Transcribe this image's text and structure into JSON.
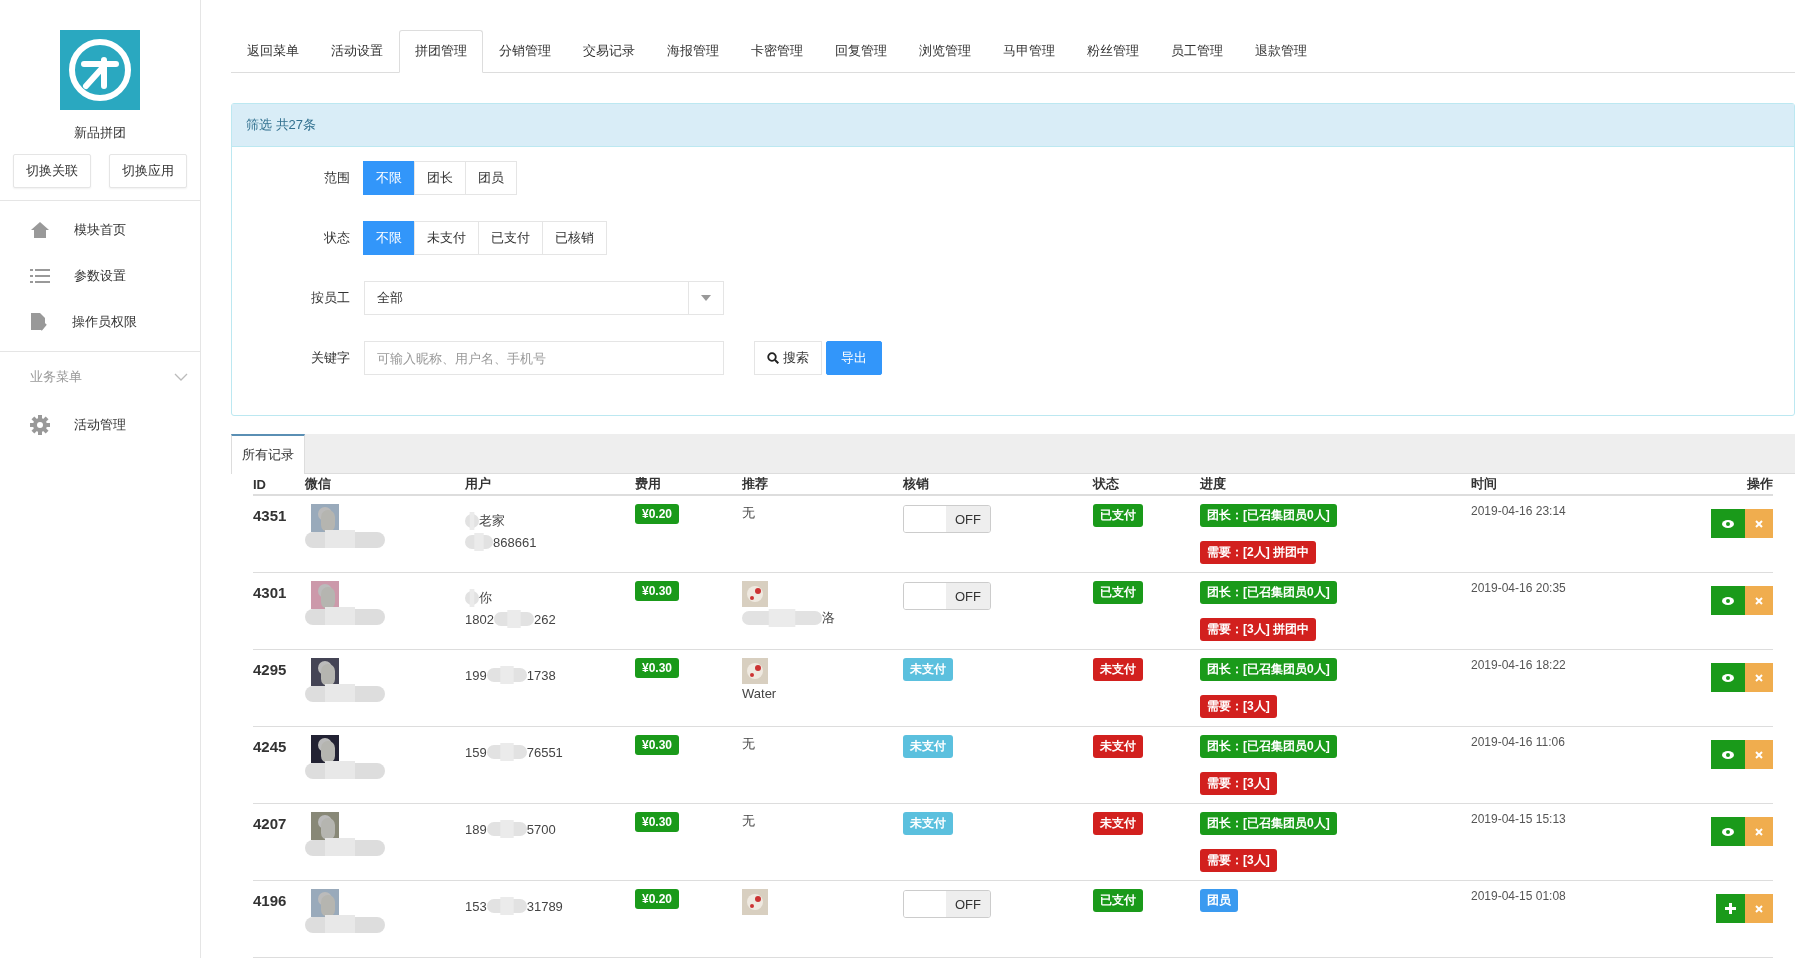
{
  "sidebar": {
    "app_name": "新品拼团",
    "buttons": [
      "切换关联",
      "切换应用"
    ],
    "items": [
      {
        "label": "模块首页"
      },
      {
        "label": "参数设置"
      },
      {
        "label": "操作员权限"
      }
    ],
    "section": {
      "title": "业务菜单",
      "expanded": true,
      "items": [
        {
          "label": "活动管理"
        }
      ]
    }
  },
  "tabs": [
    {
      "label": "返回菜单",
      "selected": false
    },
    {
      "label": "活动设置",
      "selected": false
    },
    {
      "label": "拼团管理",
      "selected": true
    },
    {
      "label": "分销管理",
      "selected": false
    },
    {
      "label": "交易记录",
      "selected": false
    },
    {
      "label": "海报管理",
      "selected": false
    },
    {
      "label": "卡密管理",
      "selected": false
    },
    {
      "label": "回复管理",
      "selected": false
    },
    {
      "label": "浏览管理",
      "selected": false
    },
    {
      "label": "马甲管理",
      "selected": false
    },
    {
      "label": "粉丝管理",
      "selected": false
    },
    {
      "label": "员工管理",
      "selected": false
    },
    {
      "label": "退款管理",
      "selected": false
    }
  ],
  "filter": {
    "title": "筛选 共27条",
    "groups": [
      {
        "label": "范围",
        "options": [
          {
            "label": "不限",
            "selected": true
          },
          {
            "label": "团长",
            "selected": false
          },
          {
            "label": "团员",
            "selected": false
          }
        ]
      },
      {
        "label": "状态",
        "options": [
          {
            "label": "不限",
            "selected": true
          },
          {
            "label": "未支付",
            "selected": false
          },
          {
            "label": "已支付",
            "selected": false
          },
          {
            "label": "已核销",
            "selected": false
          }
        ]
      }
    ],
    "staff": {
      "label": "按员工",
      "value": "全部"
    },
    "keyword": {
      "label": "关键字",
      "placeholder": "可输入昵称、用户名、手机号"
    },
    "search_button": "搜索",
    "export_button": "导出"
  },
  "records": {
    "tab": "所有记录",
    "columns": [
      "ID",
      "微信",
      "用户",
      "费用",
      "推荐",
      "核销",
      "状态",
      "进度",
      "时间",
      "操作"
    ],
    "rows": [
      {
        "id": "4351",
        "user": {
          "name": "老家",
          "phone_end": "868661"
        },
        "fee": "¥0.20",
        "recommend": {
          "kind": "none",
          "text": "无"
        },
        "verify": {
          "kind": "toggle",
          "on": false,
          "text": "OFF"
        },
        "status": {
          "text": "已支付",
          "color": "#1a9a1a"
        },
        "progress": [
          {
            "text": "团长：[已召集团员0人]",
            "color": "#1a9a1a"
          },
          {
            "text": "需要：[2人] 拼团中",
            "color": "#d2201e"
          }
        ],
        "time": "2019-04-16 23:14",
        "kind": "leader"
      },
      {
        "id": "4301",
        "user": {
          "name": "你",
          "phone_start": "1802",
          "phone_end": "262"
        },
        "fee": "¥0.30",
        "recommend": {
          "kind": "blurred",
          "text": "洛"
        },
        "verify": {
          "kind": "toggle",
          "on": false,
          "text": "OFF"
        },
        "status": {
          "text": "已支付",
          "color": "#1a9a1a"
        },
        "progress": [
          {
            "text": "团长：[已召集团员0人]",
            "color": "#1a9a1a"
          },
          {
            "text": "需要：[3人] 拼团中",
            "color": "#d2201e"
          }
        ],
        "time": "2019-04-16 20:35",
        "kind": "leader"
      },
      {
        "id": "4295",
        "user": {
          "phone_start": "199",
          "phone_end": "1738"
        },
        "fee": "¥0.30",
        "recommend": {
          "kind": "avatar",
          "text": "Water"
        },
        "verify": {
          "kind": "badge",
          "text": "未支付"
        },
        "status": {
          "text": "未支付",
          "color": "#d2201e"
        },
        "progress": [
          {
            "text": "团长：[已召集团员0人]",
            "color": "#1a9a1a"
          },
          {
            "text": "需要：[3人]",
            "color": "#d2201e"
          }
        ],
        "time": "2019-04-16 18:22",
        "kind": "leader"
      },
      {
        "id": "4245",
        "user": {
          "phone_start": "159",
          "phone_end": "76551"
        },
        "fee": "¥0.30",
        "recommend": {
          "kind": "none",
          "text": "无"
        },
        "verify": {
          "kind": "badge",
          "text": "未支付"
        },
        "status": {
          "text": "未支付",
          "color": "#d2201e"
        },
        "progress": [
          {
            "text": "团长：[已召集团员0人]",
            "color": "#1a9a1a"
          },
          {
            "text": "需要：[3人]",
            "color": "#d2201e"
          }
        ],
        "time": "2019-04-16 11:06",
        "kind": "leader"
      },
      {
        "id": "4207",
        "user": {
          "phone_start": "189",
          "phone_end": "5700"
        },
        "fee": "¥0.30",
        "recommend": {
          "kind": "none",
          "text": "无"
        },
        "verify": {
          "kind": "badge",
          "text": "未支付"
        },
        "status": {
          "text": "未支付",
          "color": "#d2201e"
        },
        "progress": [
          {
            "text": "团长：[已召集团员0人]",
            "color": "#1a9a1a"
          },
          {
            "text": "需要：[3人]",
            "color": "#d2201e"
          }
        ],
        "time": "2019-04-15 15:13",
        "kind": "leader"
      },
      {
        "id": "4196",
        "user": {
          "phone_start": "153",
          "phone_end": "31789"
        },
        "fee": "¥0.20",
        "recommend": {
          "kind": "avatar"
        },
        "verify": {
          "kind": "toggle",
          "on": false,
          "text": "OFF"
        },
        "status": {
          "text": "已支付",
          "color": "#1a9a1a"
        },
        "progress": [
          {
            "text": "团员",
            "color": "#3a9af0"
          }
        ],
        "time": "2019-04-15 01:08",
        "kind": "member"
      }
    ]
  }
}
